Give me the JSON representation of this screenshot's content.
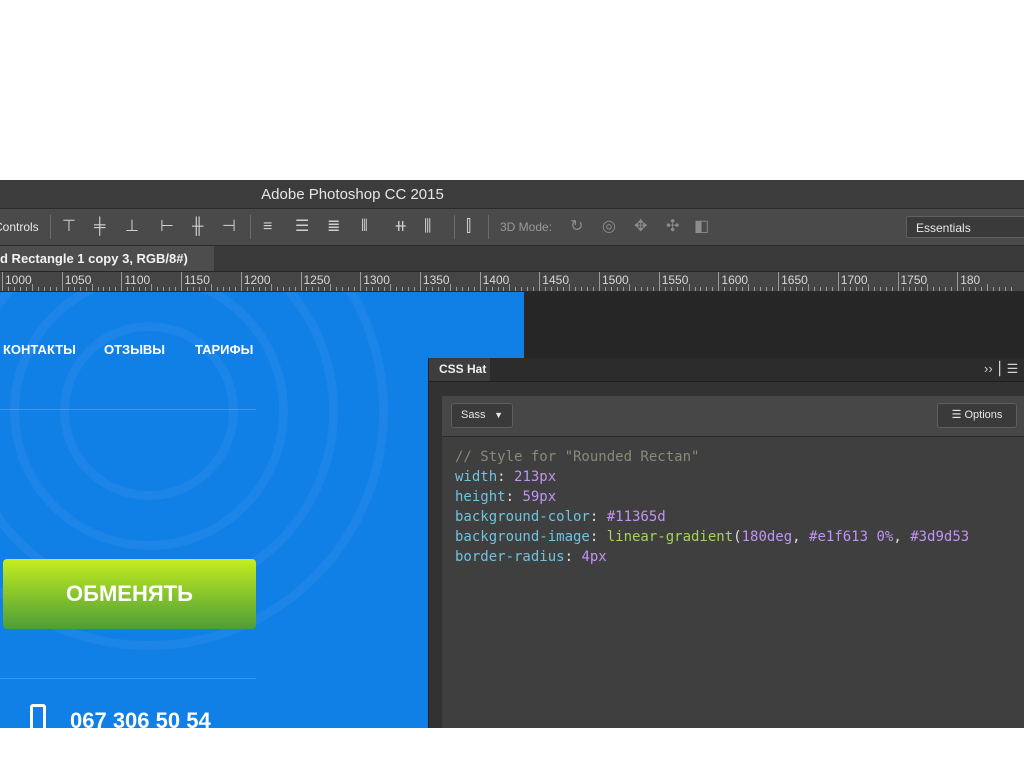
{
  "app": {
    "title": "Adobe Photoshop CC 2015"
  },
  "options_bar": {
    "controls_label": "Controls",
    "mode_3d_label": "3D Mode:",
    "workspace": "Essentials"
  },
  "document": {
    "tab_label": "d Rectangle 1 copy 3, RGB/8#)"
  },
  "ruler": {
    "labels": [
      "1000",
      "1050",
      "1100",
      "1150",
      "1200",
      "1250",
      "1300",
      "1350",
      "1400",
      "1450",
      "1500",
      "1550",
      "1600",
      "1650",
      "1700",
      "1750",
      "180"
    ]
  },
  "site": {
    "nav": [
      "КОНТАКТЫ",
      "ОТЗЫВЫ",
      "ТАРИФЫ"
    ],
    "cta_label": "ОБМЕНЯТЬ",
    "phone": "067 306 50 54"
  },
  "panel": {
    "tab_label": "CSS Hat",
    "syntax_select": "Sass",
    "options_label": "Options",
    "code": {
      "comment": "// Style for \"Rounded Rectan\"",
      "width_prop": "width",
      "width_val": "213px",
      "height_prop": "height",
      "height_val": "59px",
      "bgcolor_prop": "background-color",
      "bgcolor_val": "#11365d",
      "bgimage_prop": "background-image",
      "bgimage_fn": "linear-gradient",
      "bgimage_deg": "180deg",
      "bgimage_c1": "#e1f613",
      "bgimage_p1": "0%",
      "bgimage_c2": "#3d9d53",
      "radius_prop": "border-radius",
      "radius_val": "4px"
    }
  },
  "colors": {
    "canvas_blue": "#107fe6",
    "cta_top": "#c5ee1f",
    "cta_bottom": "#4d9d38"
  }
}
